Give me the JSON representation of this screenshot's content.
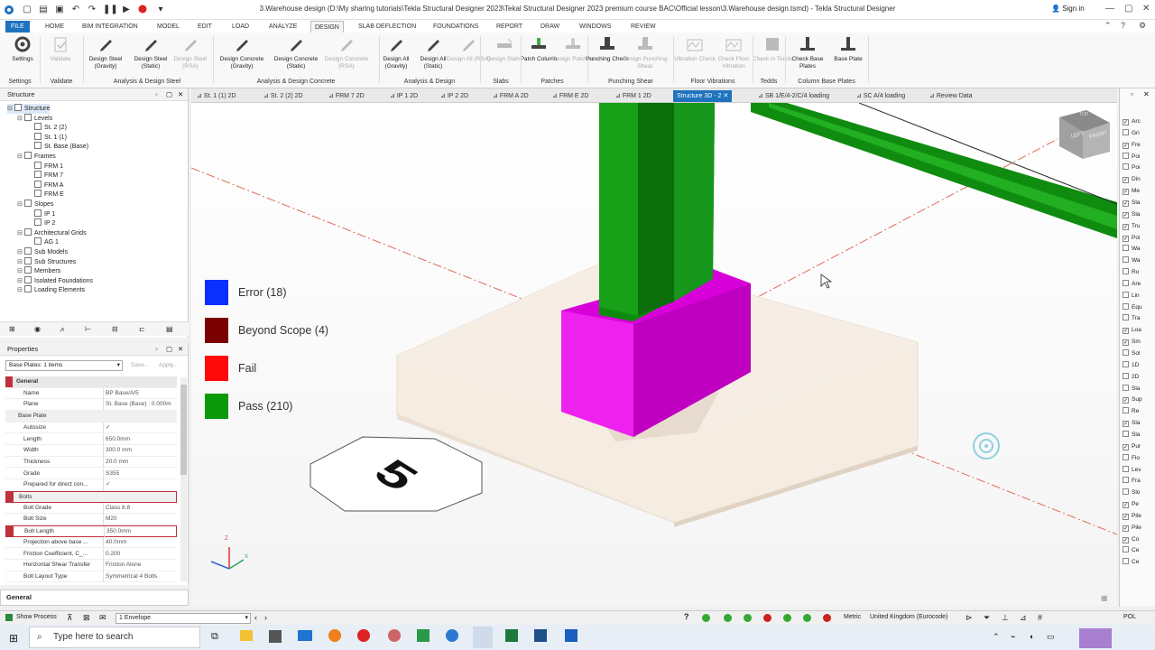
{
  "window": {
    "title": "3.Warehouse design (D:\\My sharing tutorials\\Tekla Structural Designer 2023\\Tekal Structural Designer 2023 premium course BAC\\Official lesson\\3.Warehouse design.tsmd) - Tekla Structural Designer",
    "signin": "Sign in"
  },
  "menu": {
    "tabs": [
      "FILE",
      "HOME",
      "BIM INTEGRATION",
      "MODEL",
      "EDIT",
      "LOAD",
      "ANALYZE",
      "DESIGN",
      "SLAB DEFLECTION",
      "FOUNDATIONS",
      "REPORT",
      "DRAW",
      "WINDOWS",
      "REVIEW"
    ],
    "active": "DESIGN"
  },
  "ribbon": {
    "buttons": [
      {
        "label": "Settings",
        "disabled": false
      },
      {
        "label": "Validate",
        "disabled": true
      },
      {
        "label": "Design Steel (Gravity)",
        "disabled": false
      },
      {
        "label": "Design Steel (Static)",
        "disabled": false
      },
      {
        "label": "Design Steel (RSA)",
        "disabled": true
      },
      {
        "label": "Design Concrete (Gravity)",
        "disabled": false
      },
      {
        "label": "Design Concrete (Static)",
        "disabled": false
      },
      {
        "label": "Design Concrete (RSA)",
        "disabled": true
      },
      {
        "label": "Design All (Gravity)",
        "disabled": false
      },
      {
        "label": "Design All (Static)",
        "disabled": false
      },
      {
        "label": "Design All (RSA)",
        "disabled": true
      },
      {
        "label": "Design Slabs",
        "disabled": true
      },
      {
        "label": "Patch Column",
        "disabled": false
      },
      {
        "label": "Design Patches",
        "disabled": true
      },
      {
        "label": "Punching Check",
        "disabled": false
      },
      {
        "label": "Design Punching Shear",
        "disabled": true
      },
      {
        "label": "Vibration Check",
        "disabled": true
      },
      {
        "label": "Check Floor Vibration",
        "disabled": true
      },
      {
        "label": "Check in Tedds",
        "disabled": true
      },
      {
        "label": "Check Base Plates",
        "disabled": false
      },
      {
        "label": "Base Plate",
        "disabled": false
      }
    ],
    "groups": [
      "Settings",
      "Validate",
      "Analysis & Design Steel",
      "Analysis & Design Concrete",
      "Analysis & Design",
      "Slabs",
      "Patches",
      "Punching Shear",
      "Floor Vibrations",
      "Tedds",
      "Column Base Plates"
    ]
  },
  "structure_panel": {
    "title": "Structure",
    "items": [
      {
        "label": "Structure",
        "level": 0,
        "selected": true
      },
      {
        "label": "Levels",
        "level": 1
      },
      {
        "label": "St. 2 (2)",
        "level": 2
      },
      {
        "label": "St. 1 (1)",
        "level": 2
      },
      {
        "label": "St. Base (Base)",
        "level": 2
      },
      {
        "label": "Frames",
        "level": 1
      },
      {
        "label": "FRM 1",
        "level": 2
      },
      {
        "label": "FRM 7",
        "level": 2
      },
      {
        "label": "FRM A",
        "level": 2
      },
      {
        "label": "FRM E",
        "level": 2
      },
      {
        "label": "Slopes",
        "level": 1
      },
      {
        "label": "IP 1",
        "level": 2
      },
      {
        "label": "IP 2",
        "level": 2
      },
      {
        "label": "Architectural Grids",
        "level": 1
      },
      {
        "label": "AG 1",
        "level": 2
      },
      {
        "label": "Sub Models",
        "level": 1
      },
      {
        "label": "Sub Structures",
        "level": 1
      },
      {
        "label": "Members",
        "level": 1
      },
      {
        "label": "Isolated Foundations",
        "level": 1
      },
      {
        "label": "Loading Elements",
        "level": 1
      }
    ]
  },
  "properties": {
    "title": "Properties",
    "selector": "Base Plates: 1 items",
    "save": "Save...",
    "apply": "Apply...",
    "rows": [
      {
        "k": "General",
        "v": "",
        "type": "sec"
      },
      {
        "k": "Name",
        "v": "BP Base/A/5",
        "type": "row"
      },
      {
        "k": "Plane",
        "v": "St. Base (Base) : 0.000m",
        "type": "row"
      },
      {
        "k": "Base Plate",
        "v": "",
        "type": "subsec"
      },
      {
        "k": "Autosize",
        "v": "✓",
        "type": "row"
      },
      {
        "k": "Length",
        "v": "650.0mm",
        "type": "row"
      },
      {
        "k": "Width",
        "v": "300.0 mm",
        "type": "row"
      },
      {
        "k": "Thickness",
        "v": "20.0 mm",
        "type": "row"
      },
      {
        "k": "Grade",
        "v": "S355",
        "type": "row"
      },
      {
        "k": "Prepared for direct con...",
        "v": "✓",
        "type": "row"
      },
      {
        "k": "Bolts",
        "v": "",
        "type": "subsec-hl"
      },
      {
        "k": "Bolt Grade",
        "v": "Class 8.8",
        "type": "row"
      },
      {
        "k": "Bolt Size",
        "v": "M20",
        "type": "row"
      },
      {
        "k": "Bolt Length",
        "v": "350.0mm",
        "type": "row-hl"
      },
      {
        "k": "Projection above base ...",
        "v": "40.0mm",
        "type": "row"
      },
      {
        "k": "Friction Coefficient, C_...",
        "v": "0.200",
        "type": "row"
      },
      {
        "k": "Horizontal Shear Transfer",
        "v": "Friction Alone",
        "type": "row"
      },
      {
        "k": "Bolt Layout Type",
        "v": "Symmetrical 4 Bolts",
        "type": "row"
      }
    ],
    "footer": "General"
  },
  "view_tabs": [
    {
      "label": "St. 1 (1) 2D"
    },
    {
      "label": "St. 2 (2) 2D"
    },
    {
      "label": "FRM 7 2D"
    },
    {
      "label": "IP 1 2D"
    },
    {
      "label": "IP 2 2D"
    },
    {
      "label": "FRM A 2D"
    },
    {
      "label": "FRM E 2D"
    },
    {
      "label": "FRM 1 2D"
    },
    {
      "label": "Structure 3D - 2",
      "active": true
    },
    {
      "label": "SB 1/E/4-2/C/4 loading"
    },
    {
      "label": "SC A/4 loading"
    },
    {
      "label": "Review Data"
    }
  ],
  "legend": [
    {
      "label": "Error (18)",
      "color": "#0a2fff"
    },
    {
      "label": "Beyond Scope (4)",
      "color": "#7a0000"
    },
    {
      "label": "Fail",
      "color": "#ff0a0a"
    },
    {
      "label": "Pass (210)",
      "color": "#0a9a0a"
    }
  ],
  "grid_marker": "5",
  "navcube": {
    "left": "LEFT",
    "front": "FRONT",
    "top": "TOP"
  },
  "axes": {
    "z": "Z",
    "x": "X"
  },
  "right_panel": [
    {
      "label": "Arc",
      "checked": true
    },
    {
      "label": "Gri",
      "checked": false
    },
    {
      "label": "Fre",
      "checked": true
    },
    {
      "label": "Poi",
      "checked": false
    },
    {
      "label": "Poi",
      "checked": false
    },
    {
      "label": "Din",
      "checked": true
    },
    {
      "label": "Me",
      "checked": true
    },
    {
      "label": "Sla",
      "checked": true
    },
    {
      "label": "Sla",
      "checked": true
    },
    {
      "label": "Tru",
      "checked": true
    },
    {
      "label": "Poi",
      "checked": true
    },
    {
      "label": "Wa",
      "checked": false
    },
    {
      "label": "Wa",
      "checked": false
    },
    {
      "label": "Ro",
      "checked": false
    },
    {
      "label": "Are",
      "checked": false
    },
    {
      "label": "Lin",
      "checked": false
    },
    {
      "label": "Equ",
      "checked": false
    },
    {
      "label": "Tra",
      "checked": false
    },
    {
      "label": "Loa",
      "checked": true
    },
    {
      "label": "Sm",
      "checked": true
    },
    {
      "label": "Sol",
      "checked": false
    },
    {
      "label": "1D",
      "checked": false
    },
    {
      "label": "2D",
      "checked": false
    },
    {
      "label": "Sla",
      "checked": false
    },
    {
      "label": "Sup",
      "checked": true
    },
    {
      "label": "Re",
      "checked": false
    },
    {
      "label": "Sla",
      "checked": true
    },
    {
      "label": "Sla",
      "checked": false
    },
    {
      "label": "Pur",
      "checked": true
    },
    {
      "label": "Flo",
      "checked": false
    },
    {
      "label": "Lev",
      "checked": false
    },
    {
      "label": "Fra",
      "checked": false
    },
    {
      "label": "Slo",
      "checked": false
    },
    {
      "label": "Pe",
      "checked": true
    },
    {
      "label": "Pile",
      "checked": true
    },
    {
      "label": "Pile",
      "checked": true
    },
    {
      "label": "Co",
      "checked": true
    },
    {
      "label": "Ce",
      "checked": false
    },
    {
      "label": "Ce",
      "checked": false
    }
  ],
  "statusbar": {
    "show_process": "Show Process",
    "envelope": "1 Envelope",
    "units": "Metric",
    "code": "United Kingdom (Eurocode)",
    "pol": "POL"
  },
  "taskbar": {
    "search_placeholder": "Type here to search"
  }
}
